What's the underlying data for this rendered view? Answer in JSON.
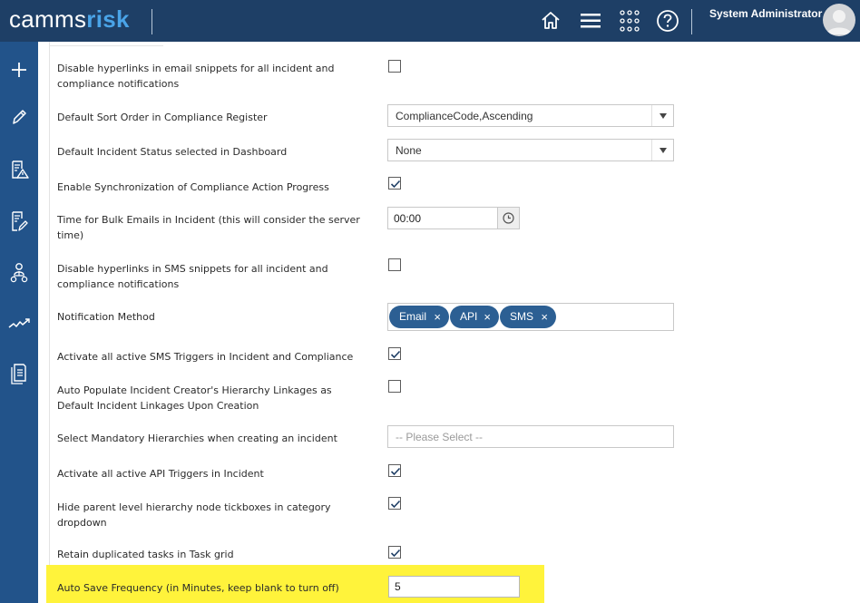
{
  "header": {
    "logo_part1": "camms",
    "logo_part2": "risk",
    "user_name": "System Administrator",
    "icons": [
      "home-icon",
      "menu-icon",
      "apps-grid-icon",
      "help-icon"
    ]
  },
  "sidebar": {
    "icons": [
      "add-icon",
      "edit-icon",
      "incident-report-icon",
      "document-edit-icon",
      "org-hierarchy-icon",
      "trend-icon",
      "document-list-icon"
    ]
  },
  "settings": {
    "disable_email_hyperlinks": {
      "label": "Disable hyperlinks in email snippets for all incident and compliance notifications",
      "checked": false
    },
    "default_sort_order": {
      "label": "Default Sort Order in Compliance Register",
      "value": "ComplianceCode,Ascending"
    },
    "default_incident_status": {
      "label": "Default Incident Status selected in Dashboard",
      "value": "None"
    },
    "enable_sync": {
      "label": "Enable Synchronization of Compliance Action Progress",
      "checked": true
    },
    "bulk_email_time": {
      "label": "Time for Bulk Emails in Incident (this will consider the server time)",
      "value": "00:00"
    },
    "disable_sms_hyperlinks": {
      "label": "Disable hyperlinks in SMS snippets for all incident and compliance notifications",
      "checked": false
    },
    "notification_method": {
      "label": "Notification Method",
      "tags": [
        "Email",
        "API",
        "SMS"
      ],
      "remove_glyph": "×"
    },
    "activate_sms_triggers": {
      "label": "Activate all active SMS Triggers in Incident and Compliance",
      "checked": true
    },
    "auto_populate_linkages": {
      "label": "Auto Populate Incident Creator's Hierarchy Linkages as Default Incident Linkages Upon Creation",
      "checked": false
    },
    "mandatory_hierarchies": {
      "label": "Select Mandatory Hierarchies when creating an incident",
      "placeholder": "-- Please Select --"
    },
    "activate_api_triggers": {
      "label": "Activate all active API Triggers in Incident",
      "checked": true
    },
    "hide_parent_tickboxes": {
      "label": "Hide parent level hierarchy node tickboxes in category dropdown",
      "checked": true
    },
    "retain_duplicated_tasks": {
      "label": "Retain duplicated tasks in Task grid",
      "checked": true
    },
    "auto_save_frequency": {
      "label": "Auto Save Frequency  (in Minutes, keep blank to turn off)",
      "value": "5"
    }
  },
  "colors": {
    "header_bg": "#1e3f66",
    "sidebar_bg": "#22538a",
    "logo_accent": "#4aa4e8",
    "tag_bg": "#2c5f93",
    "highlight": "#fff33b"
  }
}
